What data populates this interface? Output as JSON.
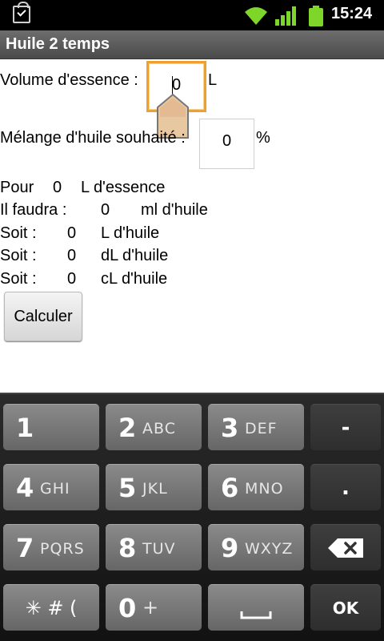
{
  "status_bar": {
    "time": "15:24",
    "icons": [
      "shopping-bag-check-icon",
      "wifi-icon",
      "cell-signal-icon",
      "battery-icon"
    ]
  },
  "title_bar": {
    "title": "Huile 2 temps"
  },
  "form": {
    "volume_label": "Volume d'essence :",
    "volume_value": "0",
    "volume_unit": "L",
    "mix_label": "Mélange d'huile souhaité :",
    "mix_value": "0",
    "mix_unit": "%"
  },
  "results": {
    "pour_label": "Pour",
    "pour_value": "0",
    "pour_unit": "L d'essence",
    "faudra_label": "Il faudra :",
    "faudra_value": "0",
    "faudra_unit": "ml d'huile",
    "soit_label": "Soit :",
    "soit_l_value": "0",
    "soit_l_unit": "L d'huile",
    "soit_dl_value": "0",
    "soit_dl_unit": "dL d'huile",
    "soit_cl_value": "0",
    "soit_cl_unit": "cL d'huile"
  },
  "calculate_button": "Calculer",
  "colors": {
    "accent_focus": "#f0a030",
    "title_bar": "#5a5a5a",
    "key": "#777777",
    "key_dark": "#363636"
  },
  "keyboard": {
    "keys": [
      {
        "num": "1",
        "letters": ""
      },
      {
        "num": "2",
        "letters": "ABC"
      },
      {
        "num": "3",
        "letters": "DEF"
      },
      {
        "symbol": "-"
      },
      {
        "num": "4",
        "letters": "GHI"
      },
      {
        "num": "5",
        "letters": "JKL"
      },
      {
        "num": "6",
        "letters": "MNO"
      },
      {
        "symbol": "."
      },
      {
        "num": "7",
        "letters": "PQRS"
      },
      {
        "num": "8",
        "letters": "TUV"
      },
      {
        "num": "9",
        "letters": "WXYZ"
      },
      {
        "icon": "backspace-icon"
      },
      {
        "symbol": "✳ # ("
      },
      {
        "num": "0",
        "letters": "+"
      },
      {
        "icon": "space-bar-icon"
      },
      {
        "symbol": "OK"
      }
    ]
  }
}
